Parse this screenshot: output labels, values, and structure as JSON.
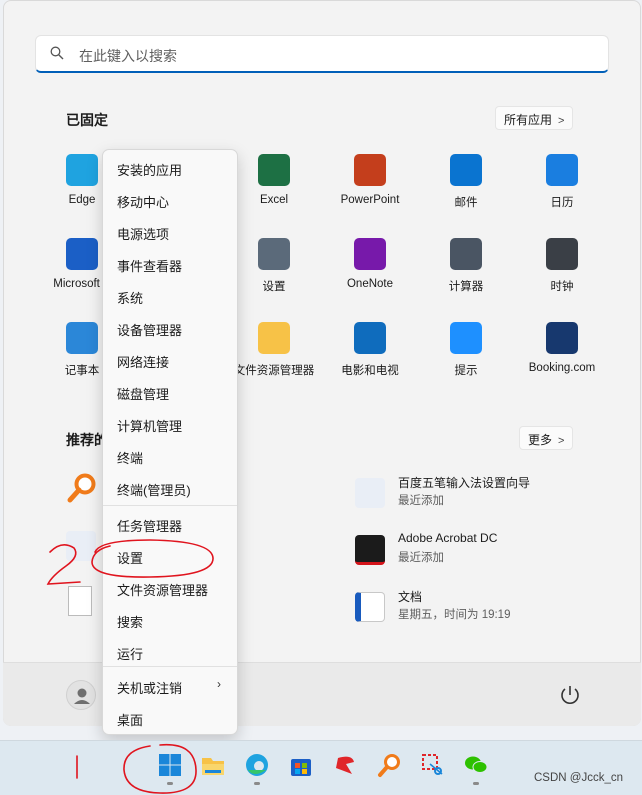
{
  "search": {
    "placeholder": "在此键入以搜索"
  },
  "pinned": {
    "title": "已固定",
    "all_apps_label": "所有应用",
    "apps": [
      {
        "label": "Edge",
        "icon": "edge-icon",
        "color": "#1fa3e0"
      },
      {
        "label": "Excel",
        "icon": "excel-icon",
        "color": "#1d7044"
      },
      {
        "label": "PowerPoint",
        "icon": "powerpoint-icon",
        "color": "#c43e1c"
      },
      {
        "label": "邮件",
        "icon": "mail-icon",
        "color": "#0a74d0"
      },
      {
        "label": "日历",
        "icon": "calendar-icon",
        "color": "#1a7ee0"
      },
      {
        "label": "Microsoft S",
        "icon": "store-icon",
        "color": "#1b5fc6"
      },
      {
        "label": "设置",
        "icon": "gear-icon",
        "color": "#5b6a7a"
      },
      {
        "label": "OneNote",
        "icon": "onenote-icon",
        "color": "#7719aa"
      },
      {
        "label": "计算器",
        "icon": "calculator-icon",
        "color": "#4a5563"
      },
      {
        "label": "时钟",
        "icon": "clock-icon",
        "color": "#3a3f46"
      },
      {
        "label": "记事本",
        "icon": "notepad-icon",
        "color": "#2b87d8"
      },
      {
        "label": "文件资源管理器",
        "icon": "folder-icon",
        "color": "#f7c247"
      },
      {
        "label": "电影和电视",
        "icon": "movies-icon",
        "color": "#0f6cbd"
      },
      {
        "label": "提示",
        "icon": "tips-icon",
        "color": "#1e90ff"
      },
      {
        "label": "Booking.com",
        "icon": "booking-icon",
        "color": "#17386e"
      }
    ]
  },
  "recommended": {
    "title": "推荐的",
    "more_label": "更多",
    "items": [
      {
        "title": "百度五笔输入法设置向导",
        "subtitle": "最近添加",
        "icon": "baidu-icon"
      },
      {
        "title": "Adobe Acrobat DC",
        "subtitle": "最近添加",
        "icon": "acrobat-icon"
      },
      {
        "title": "文档",
        "subtitle": "星期五，时间为 19:19",
        "icon": "word-icon"
      }
    ]
  },
  "context_menu": {
    "items": [
      "安装的应用",
      "移动中心",
      "电源选项",
      "事件查看器",
      "系统",
      "设备管理器",
      "网络连接",
      "磁盘管理",
      "计算机管理",
      "终端",
      "终端(管理员)",
      "任务管理器",
      "设置",
      "文件资源管理器",
      "搜索",
      "运行",
      "关机或注销",
      "桌面"
    ],
    "submenu_arrow": "›"
  },
  "watermark": "CSDN @Jcck_cn",
  "colors": {
    "accent": "#005fb8",
    "annotation": "#e0141e"
  }
}
